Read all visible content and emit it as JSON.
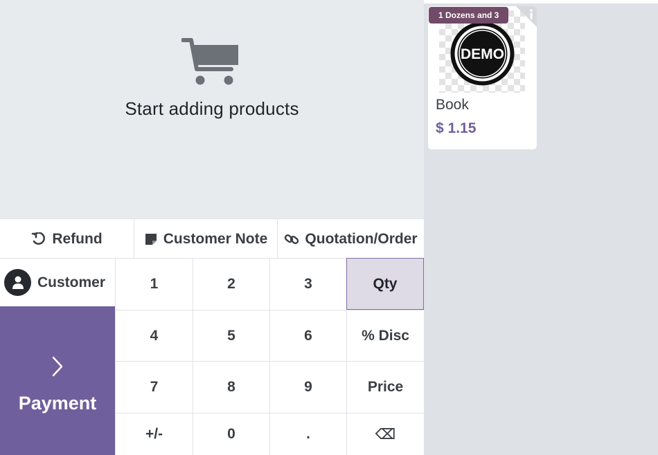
{
  "order": {
    "empty_text": "Start adding products",
    "empty_icon": "cart-icon"
  },
  "controls": {
    "refund": "Refund",
    "customer_note": "Customer Note",
    "quotation_order": "Quotation/Order"
  },
  "customer": {
    "label": "Customer"
  },
  "payment": {
    "label": "Payment"
  },
  "numpad": {
    "k1": "1",
    "k2": "2",
    "k3": "3",
    "qty": "Qty",
    "k4": "4",
    "k5": "5",
    "k6": "6",
    "disc": "% Disc",
    "k7": "7",
    "k8": "8",
    "k9": "9",
    "price": "Price",
    "plusminus": "+/-",
    "k0": "0",
    "dot": ".",
    "backspace": "⌫",
    "active_mode": "Qty"
  },
  "products": [
    {
      "name": "Book",
      "price": "$ 1.15",
      "badge": "1 Dozens and 3",
      "image_text": "DEMO"
    }
  ],
  "colors": {
    "accent": "#6f5f9c",
    "badge": "#714b67",
    "active_key_bg": "#dedbe7",
    "pane_bg": "#e8ebee"
  }
}
